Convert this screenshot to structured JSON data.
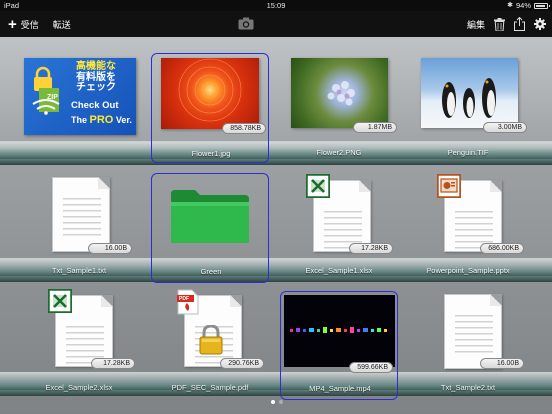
{
  "status_bar": {
    "device": "iPad",
    "time": "15:09",
    "battery": "94%"
  },
  "toolbar": {
    "receive_label": "受信",
    "transfer_label": "転送",
    "edit_label": "編集"
  },
  "ad_banner": {
    "jp_line1": "高機能な",
    "jp_line2": "有料版を",
    "jp_line3": "チェック",
    "en_line1": "Check Out",
    "en_line2_prefix": "The",
    "en_line2_pro": "PRO",
    "en_line2_suffix": "Ver.",
    "zip_label": "ZIP"
  },
  "files": [
    {
      "name": "Flower1.jpg",
      "size": "858.78KB",
      "selected": true
    },
    {
      "name": "Flower2.PNG",
      "size": "1.87MB",
      "selected": false
    },
    {
      "name": "Penguin.TIF",
      "size": "3.00MB",
      "selected": false
    },
    {
      "name": "Txt_Sample1.txt",
      "size": "16.00B",
      "selected": false
    },
    {
      "name": "Green",
      "size": "",
      "selected": true
    },
    {
      "name": "Excel_Sample1.xlsx",
      "size": "17.28KB",
      "selected": false
    },
    {
      "name": "Powerpoint_Sample.pptx",
      "size": "686.00KB",
      "selected": false
    },
    {
      "name": "Excel_Sample2.xlsx",
      "size": "17.28KB",
      "selected": false
    },
    {
      "name": "PDF_SEC_Sample.pdf",
      "size": "290.76KB",
      "selected": false
    },
    {
      "name": "MP4_Sample.mp4",
      "size": "599.66KB",
      "selected": true
    },
    {
      "name": "Txt_Sample2.txt",
      "size": "16.00B",
      "selected": false
    }
  ],
  "icons": {
    "add": "plus-icon",
    "camera": "camera-icon",
    "trash": "trash-icon",
    "share": "share-icon",
    "settings": "gear-icon",
    "pdf_badge": "PDF"
  }
}
